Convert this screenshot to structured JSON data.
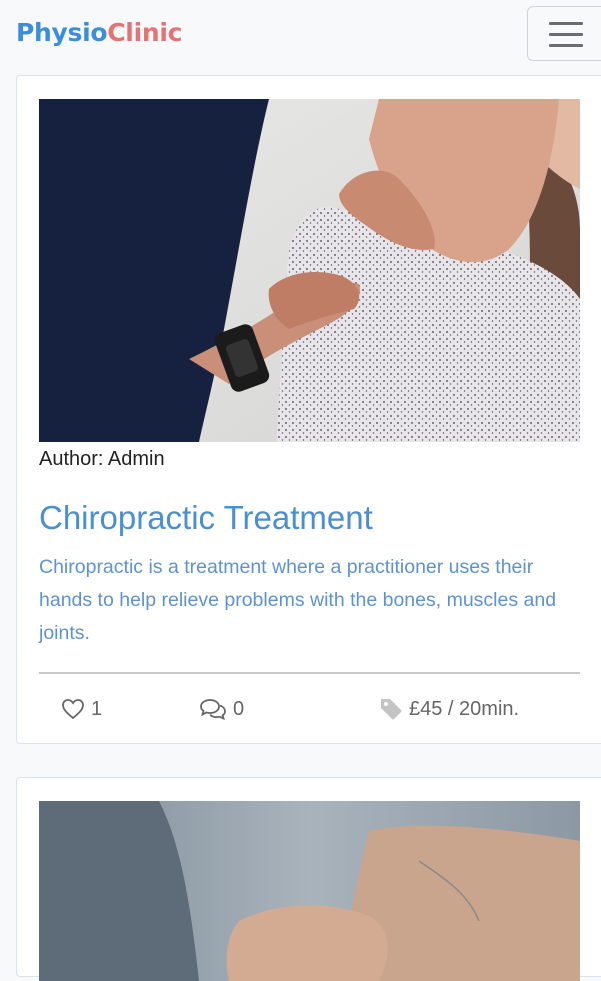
{
  "brand": {
    "part1": "Physio",
    "part2": "Clinic"
  },
  "nav": {
    "toggle_icon": "hamburger-icon"
  },
  "posts": [
    {
      "author": "Author: Admin",
      "title": "Chiropractic Treatment",
      "description": "Chiropractic is a treatment where a practitioner uses their hands to help relieve problems with the bones, muscles and joints.",
      "likes": "1",
      "comments": "0",
      "price": "£45 / 20min.",
      "image_icon": "photo-chiropractic"
    },
    {
      "image_icon": "photo-massage"
    }
  ],
  "colors": {
    "brand_blue": "#3d8ddd",
    "brand_red": "#e57373",
    "title_blue": "#4a8fd1"
  }
}
